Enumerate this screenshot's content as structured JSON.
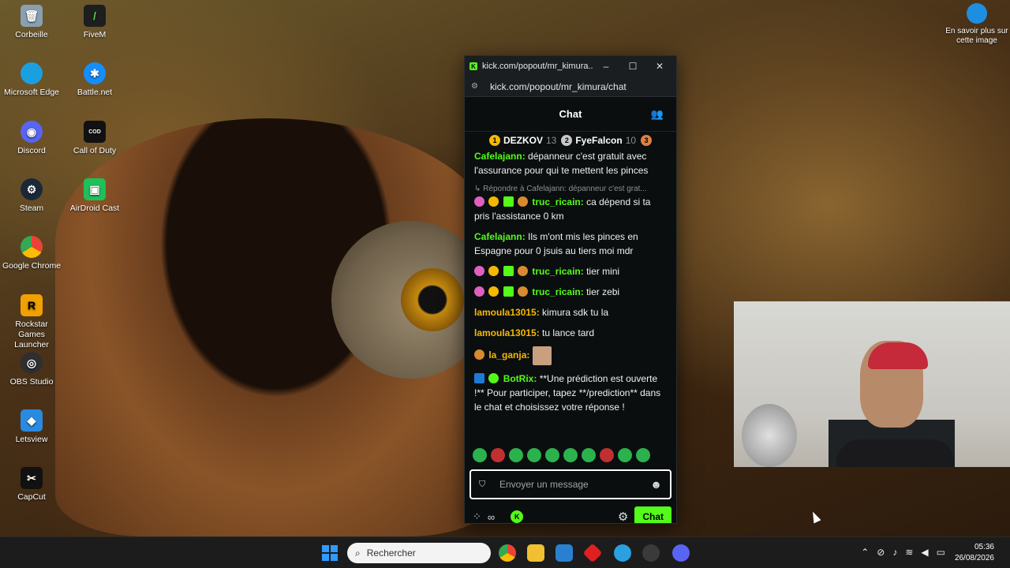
{
  "desktop": {
    "icons_left": [
      {
        "label": "Corbeille",
        "color": "#8aa0b0"
      },
      {
        "label": "Microsoft Edge",
        "color": "#1aa0e0"
      },
      {
        "label": "Discord",
        "color": "#5865f2"
      },
      {
        "label": "Steam",
        "color": "#1b2838"
      },
      {
        "label": "Google Chrome",
        "color": "#e0a020"
      },
      {
        "label": "Rockstar Games Launcher",
        "color": "#f0a000"
      },
      {
        "label": "OBS Studio",
        "color": "#302e31"
      },
      {
        "label": "Letsview",
        "color": "#2a8ae0"
      },
      {
        "label": "CapCut",
        "color": "#111111"
      }
    ],
    "icons_right_col": [
      {
        "label": "FiveM",
        "color": "#1e1e1e"
      },
      {
        "label": "Battle.net",
        "color": "#148eff"
      },
      {
        "label": "Call of Duty",
        "color": "#111111"
      },
      {
        "label": "AirDroid Cast",
        "color": "#1fbf5a"
      }
    ],
    "info_corner": "En savoir plus sur cette image"
  },
  "browser": {
    "tab_title": "kick.com/popout/mr_kimura...",
    "url": "kick.com/popout/mr_kimura/chat",
    "controls": {
      "minimize": "–",
      "maximize": "☐",
      "close": "✕"
    }
  },
  "chat": {
    "header_title": "Chat",
    "leaderboard": [
      {
        "rank": "1",
        "name": "DEZKOV",
        "count": "13",
        "color": "#f5b800"
      },
      {
        "rank": "2",
        "name": "FyeFalcon",
        "count": "10",
        "color": "#c8c8c8"
      },
      {
        "rank": "3",
        "name": "",
        "count": "",
        "color": "#e08040"
      }
    ],
    "messages": [
      {
        "user": "Cafelajann",
        "sep": ":",
        "text": " dépanneur c'est gratuit avec l'assurance pour qui te mettent les pinces",
        "color": "#53fc18"
      },
      {
        "reply": "↳ Répondre à Cafelajann: dépanneur c'est grat...",
        "user": "truc_ricain",
        "sep": ":",
        "text": " ca dépend si ta pris l'assistance 0 km",
        "color": "#53fc18"
      },
      {
        "user": "Cafelajann",
        "sep": ":",
        "text": " Ils m'ont mis les pinces en Espagne pour 0 jsuis au tiers moi mdr",
        "color": "#53fc18"
      },
      {
        "user": "truc_ricain",
        "sep": ":",
        "text": " tier mini",
        "color": "#53fc18"
      },
      {
        "user": "truc_ricain",
        "sep": ":",
        "text": " tier zebi",
        "color": "#53fc18"
      },
      {
        "user": "lamoula13015",
        "sep": ":",
        "text": " kimura sdk tu la",
        "color": "#f5b800"
      },
      {
        "user": "lamoula13015",
        "sep": ":",
        "text": " tu lance tard",
        "color": "#f5b800"
      },
      {
        "user": "la_ganja",
        "sep": ":",
        "text": "",
        "color": "#f5b800"
      },
      {
        "user": "BotRix",
        "sep": ":",
        "text": " **Une prédiction est ouverte !** Pour participer, tapez **/prediction** dans le chat et choisissez votre réponse !",
        "color": "#53fc18"
      }
    ],
    "input_placeholder": "Envoyer un message",
    "send_label": "Chat",
    "accent": "#53fc18"
  },
  "taskbar": {
    "search_placeholder": "Rechercher",
    "time": "05:36",
    "date": "26/08/2026"
  }
}
